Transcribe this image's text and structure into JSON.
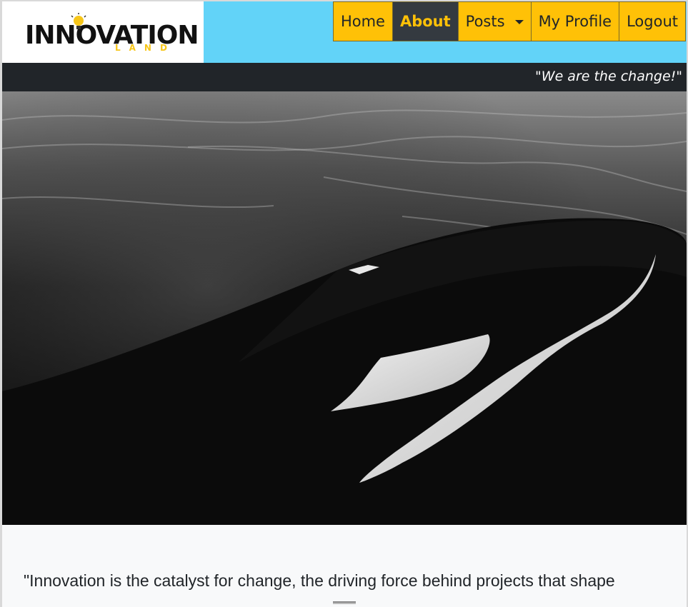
{
  "header": {
    "logo": {
      "word": "INNOVATION",
      "sub": "LAND"
    },
    "nav": [
      {
        "label": "Home",
        "active": false
      },
      {
        "label": "About",
        "active": true
      },
      {
        "label": "Posts",
        "active": false,
        "dropdown": true
      },
      {
        "label": "My Profile",
        "active": false
      },
      {
        "label": "Logout",
        "active": false
      }
    ]
  },
  "tagline": "\"We are the change!\"",
  "hero": {
    "subject": "orca-surfacing-photo"
  },
  "quote": "\"Innovation is the catalyst for change, the driving force behind projects that shape",
  "colors": {
    "topbar": "#62d3f8",
    "nav": "#ffc107",
    "nav_active": "#343a40",
    "tagline_bar": "#212529"
  }
}
